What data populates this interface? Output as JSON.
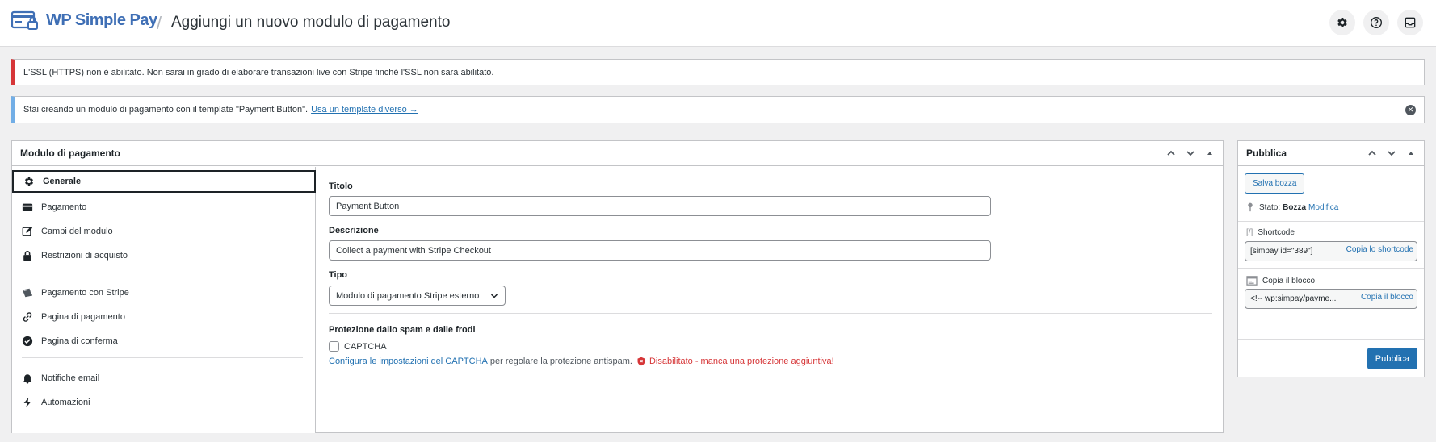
{
  "header": {
    "brand": "WP Simple Pay",
    "separator": "/",
    "title": "Aggiungi un nuovo modulo di pagamento",
    "icons": [
      "gear-icon",
      "help-icon",
      "inbox-icon"
    ]
  },
  "notices": {
    "ssl": "L'SSL (HTTPS) non è abilitato. Non sarai in grado di elaborare transazioni live con Stripe finché l'SSL non sarà abilitato.",
    "template_text": "Stai creando un modulo di pagamento con il template \"Payment Button\".",
    "template_link": "Usa un template diverso →"
  },
  "form_panel": {
    "title": "Modulo di pagamento",
    "tabs": [
      {
        "label": "Generale",
        "icon": "gear-icon",
        "active": true
      },
      {
        "label": "Pagamento",
        "icon": "credit-card-icon"
      },
      {
        "label": "Campi del modulo",
        "icon": "edit-icon"
      },
      {
        "label": "Restrizioni di acquisto",
        "icon": "lock-icon"
      },
      {
        "label": "Pagamento con Stripe",
        "icon": "stripe-icon"
      },
      {
        "label": "Pagina di pagamento",
        "icon": "link-icon"
      },
      {
        "label": "Pagina di conferma",
        "icon": "check-circle-icon"
      },
      {
        "label": "Notifiche email",
        "icon": "bell-icon"
      },
      {
        "label": "Automazioni",
        "icon": "bolt-icon"
      }
    ],
    "fields": {
      "title_label": "Titolo",
      "title_value": "Payment Button",
      "description_label": "Descrizione",
      "description_value": "Collect a payment with Stripe Checkout",
      "type_label": "Tipo",
      "type_value": "Modulo di pagamento Stripe esterno",
      "spam_label": "Protezione dallo spam e dalle frodi",
      "captcha_label": "CAPTCHA",
      "captcha_link": "Configura le impostazioni del CAPTCHA",
      "captcha_text": "per regolare la protezione antispam.",
      "captcha_status": "Disabilitato - manca una protezione aggiuntiva!"
    }
  },
  "publish": {
    "title": "Pubblica",
    "save_draft": "Salva bozza",
    "status_label": "Stato:",
    "status_value": "Bozza",
    "status_edit": "Modifica",
    "shortcode_label": "Shortcode",
    "shortcode_value": "[simpay id=\"389\"]",
    "shortcode_copy": "Copia lo shortcode",
    "block_label": "Copia il blocco",
    "block_value": "<!-- wp:simpay/payme...",
    "block_copy": "Copia il blocco",
    "publish_button": "Pubblica"
  },
  "colors": {
    "accent": "#2271b1",
    "error": "#d63638",
    "info": "#72aee6",
    "brand": "#3f6fb5"
  }
}
